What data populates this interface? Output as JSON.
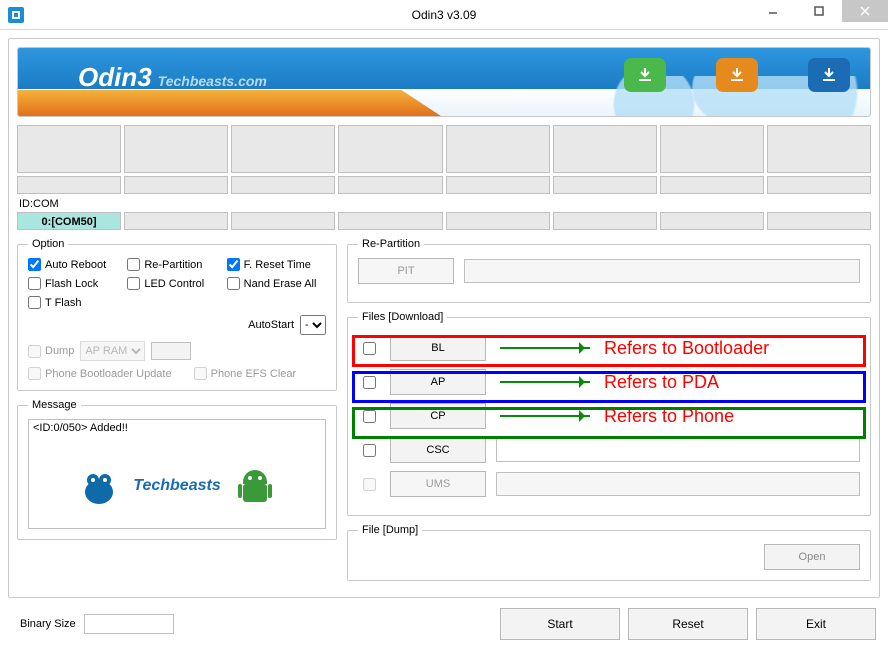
{
  "window": {
    "title": "Odin3 v3.09"
  },
  "banner": {
    "title": "Odin3",
    "subtitle": "Techbeasts.com"
  },
  "idcom": {
    "label": "ID:COM",
    "active": "0:[COM50]"
  },
  "options": {
    "legend": "Option",
    "auto_reboot": "Auto Reboot",
    "re_partition": "Re-Partition",
    "f_reset_time": "F. Reset Time",
    "flash_lock": "Flash Lock",
    "led_control": "LED Control",
    "nand_erase_all": "Nand Erase All",
    "t_flash": "T Flash",
    "autostart_label": "AutoStart",
    "autostart_value": "-",
    "dump": "Dump",
    "dump_select": "AP RAM",
    "phone_bootloader_update": "Phone Bootloader Update",
    "phone_efs_clear": "Phone EFS Clear"
  },
  "message": {
    "legend": "Message",
    "text": "<ID:0/050> Added!!",
    "logo_text": "Techbeasts"
  },
  "repartition": {
    "legend": "Re-Partition",
    "pit": "PIT"
  },
  "files": {
    "legend": "Files [Download]",
    "bl": "BL",
    "ap": "AP",
    "cp": "CP",
    "csc": "CSC",
    "ums": "UMS"
  },
  "file_dump": {
    "legend": "File [Dump]",
    "open": "Open"
  },
  "annotations": {
    "bl": "Refers to Bootloader",
    "ap": "Refers to PDA",
    "cp": "Refers to Phone"
  },
  "footer": {
    "binary_size_label": "Binary Size",
    "start": "Start",
    "reset": "Reset",
    "exit": "Exit"
  }
}
